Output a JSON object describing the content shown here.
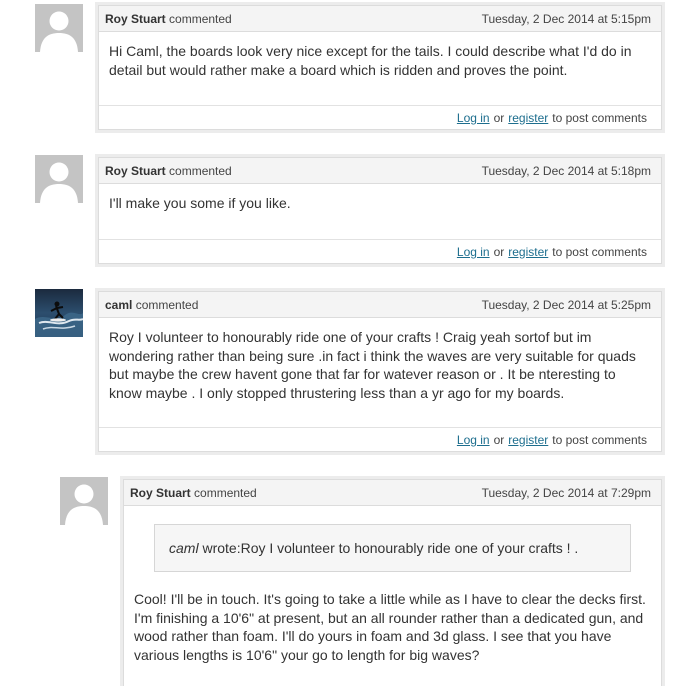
{
  "comments": [
    {
      "author": "Roy Stuart",
      "verb": "commented",
      "date": "Tuesday, 2 Dec 2014 at 5:15pm",
      "body": "Hi Caml, the boards look very nice except for the tails. I could describe what I'd do in detail but would rather make a board which is ridden and proves the point.",
      "avatar": "default-user-icon"
    },
    {
      "author": "Roy Stuart",
      "verb": "commented",
      "date": "Tuesday, 2 Dec 2014 at 5:18pm",
      "body": "I'll make you some if you like.",
      "avatar": "default-user-icon"
    },
    {
      "author": "caml",
      "verb": "commented",
      "date": "Tuesday, 2 Dec 2014 at 5:25pm",
      "body": "Roy I volunteer to honourably ride one of your crafts ! Craig yeah sortof but im wondering rather than being sure .in fact i think the waves are very suitable for quads but maybe the crew havent gone that far for watever reason or . It be nteresting to know maybe . I only stopped thrustering less than a yr ago for my boards.",
      "avatar": "surfer-photo"
    },
    {
      "author": "Roy Stuart",
      "verb": "commented",
      "date": "Tuesday, 2 Dec 2014 at 7:29pm",
      "quote_author": "caml",
      "quote_text": "wrote:Roy I volunteer to honourably ride one of your crafts ! .",
      "body": "Cool! I'll be in touch. It's going to take a little while as I have to clear the decks first. I'm finishing a 10'6\" at present, but an all rounder rather than a dedicated gun, and wood rather than foam. I'll do yours in foam and 3d glass. I see that you have various lengths is 10'6\" your go to length for big waves?",
      "avatar": "default-user-icon"
    }
  ],
  "footer": {
    "login": "Log in",
    "or": "or",
    "register": "register",
    "suffix": "to post comments"
  },
  "colors": {
    "link": "#1d6e8e",
    "header_bg": "#f4f4f4",
    "border": "#dcdcdc"
  }
}
